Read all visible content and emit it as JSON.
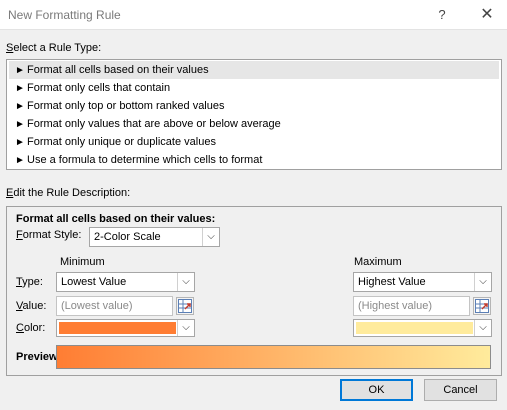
{
  "window": {
    "title": "New Formatting Rule",
    "help_glyph": "?",
    "close_glyph": "✕"
  },
  "rule_type": {
    "section_label_prefix": "S",
    "section_label_rest": "elect a Rule Type:",
    "items": [
      "Format all cells based on their values",
      "Format only cells that contain",
      "Format only top or bottom ranked values",
      "Format only values that are above or below average",
      "Format only unique or duplicate values",
      "Use a formula to determine which cells to format"
    ],
    "item_glyph": "►",
    "selected_index": 0
  },
  "description": {
    "section_label_prefix": "E",
    "section_label_rest": "dit the Rule Description:",
    "heading": "Format all cells based on their values:",
    "format_style_label_prefix": "F",
    "format_style_label_rest": "ormat Style:",
    "format_style_value": "2-Color Scale",
    "row_labels": {
      "type_prefix": "T",
      "type_rest": "ype:",
      "value_prefix": "V",
      "value_rest": "alue:",
      "color_prefix": "C",
      "color_rest": "olor:"
    },
    "minimum": {
      "header": "Minimum",
      "type_value": "Lowest Value",
      "value_placeholder": "(Lowest value)",
      "color": "#ff7d33"
    },
    "maximum": {
      "header": "Maximum",
      "type_value": "Highest Value",
      "value_placeholder": "(Highest value)",
      "color": "#ffeb9c"
    },
    "preview_label": "Preview:"
  },
  "buttons": {
    "ok": "OK",
    "cancel": "Cancel"
  },
  "icons": {
    "dropdown": "chevron-down-icon",
    "range_picker": "range-picker-icon"
  }
}
